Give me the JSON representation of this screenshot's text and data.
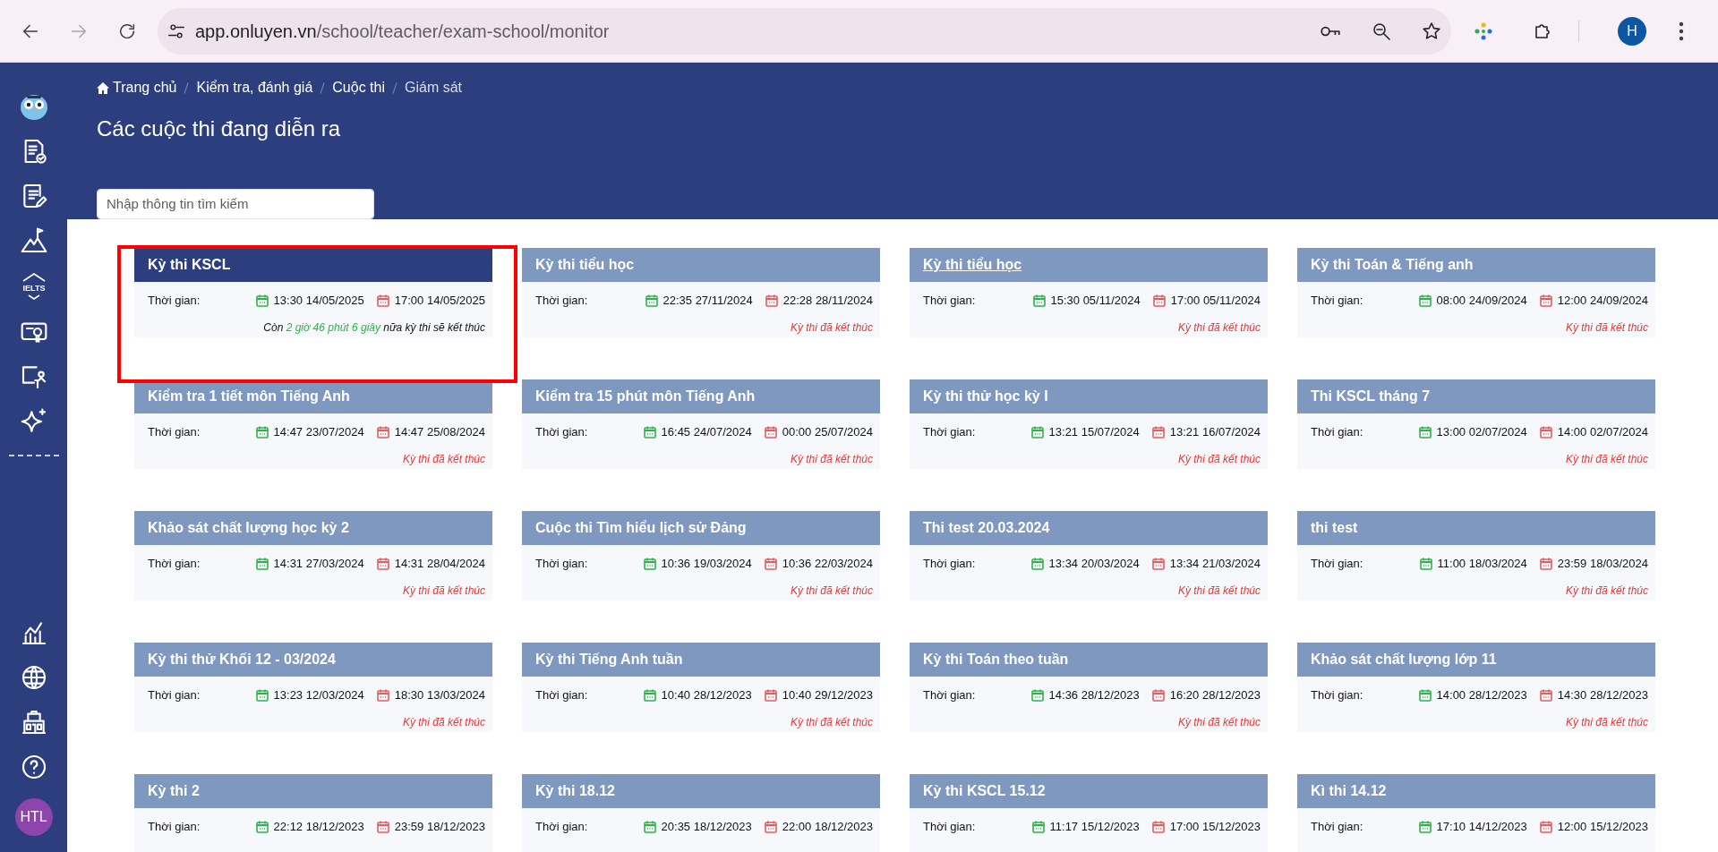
{
  "browser": {
    "url_domain": "app.onluyen.vn",
    "url_path": "/school/teacher/exam-school/monitor",
    "forward_disabled": true,
    "profile": "H"
  },
  "sidebar": {
    "ielts_label": "IELTS",
    "avatar": "HTL"
  },
  "breadcrumb": [
    {
      "label": "Trang chủ",
      "home": true
    },
    {
      "label": "Kiểm tra, đánh giá",
      "home": false
    },
    {
      "label": "Cuộc thi",
      "home": false
    },
    {
      "label": "Giám sát",
      "home": false
    }
  ],
  "page_title": "Các cuộc thi đang diễn ra",
  "search": {
    "placeholder": "Nhập thông tin tìm kiếm"
  },
  "exams": [
    {
      "title": "Kỳ thi KSCL",
      "selected": true,
      "underlined": false,
      "time_label": "Thời gian:",
      "start": "13:30 14/05/2025",
      "end": "17:00 14/05/2025",
      "status": {
        "kind": "countdown",
        "prefix": "Còn",
        "remaining": "2 giờ 46 phút 6 giây",
        "suffix": "nữa kỳ thi sẽ kết thúc"
      }
    },
    {
      "title": "Kỳ thi tiểu học",
      "selected": false,
      "underlined": false,
      "time_label": "Thời gian:",
      "start": "22:35 27/11/2024",
      "end": "22:28 28/11/2024",
      "status": {
        "kind": "ended",
        "text": "Kỳ thi đã kết thúc"
      }
    },
    {
      "title": "Kỳ thi tiểu học",
      "selected": false,
      "underlined": true,
      "time_label": "Thời gian:",
      "start": "15:30 05/11/2024",
      "end": "17:00 05/11/2024",
      "status": {
        "kind": "ended",
        "text": "Kỳ thi đã kết thúc"
      }
    },
    {
      "title": "Kỳ thi Toán & Tiếng anh",
      "selected": false,
      "underlined": false,
      "time_label": "Thời gian:",
      "start": "08:00 24/09/2024",
      "end": "12:00 24/09/2024",
      "status": {
        "kind": "ended",
        "text": "Kỳ thi đã kết thúc"
      }
    },
    {
      "title": "Kiểm tra 1 tiết môn Tiếng Anh",
      "selected": false,
      "underlined": false,
      "time_label": "Thời gian:",
      "start": "14:47 23/07/2024",
      "end": "14:47 25/08/2024",
      "status": {
        "kind": "ended",
        "text": "Kỳ thi đã kết thúc"
      }
    },
    {
      "title": "Kiểm tra 15 phút môn Tiếng Anh",
      "selected": false,
      "underlined": false,
      "time_label": "Thời gian:",
      "start": "16:45 24/07/2024",
      "end": "00:00 25/07/2024",
      "status": {
        "kind": "ended",
        "text": "Kỳ thi đã kết thúc"
      }
    },
    {
      "title": "Kỳ thi thử học kỳ I",
      "selected": false,
      "underlined": false,
      "time_label": "Thời gian:",
      "start": "13:21 15/07/2024",
      "end": "13:21 16/07/2024",
      "status": {
        "kind": "ended",
        "text": "Kỳ thi đã kết thúc"
      }
    },
    {
      "title": "Thi KSCL tháng 7",
      "selected": false,
      "underlined": false,
      "time_label": "Thời gian:",
      "start": "13:00 02/07/2024",
      "end": "14:00 02/07/2024",
      "status": {
        "kind": "ended",
        "text": "Kỳ thi đã kết thúc"
      }
    },
    {
      "title": "Khảo sát chất lượng học kỳ 2",
      "selected": false,
      "underlined": false,
      "time_label": "Thời gian:",
      "start": "14:31 27/03/2024",
      "end": "14:31 28/04/2024",
      "status": {
        "kind": "ended",
        "text": "Kỳ thi đã kết thúc"
      }
    },
    {
      "title": "Cuộc thi Tìm hiểu lịch sử Đảng",
      "selected": false,
      "underlined": false,
      "time_label": "Thời gian:",
      "start": "10:36 19/03/2024",
      "end": "10:36 22/03/2024",
      "status": {
        "kind": "ended",
        "text": "Kỳ thi đã kết thúc"
      }
    },
    {
      "title": "Thi test 20.03.2024",
      "selected": false,
      "underlined": false,
      "time_label": "Thời gian:",
      "start": "13:34 20/03/2024",
      "end": "13:34 21/03/2024",
      "status": {
        "kind": "ended",
        "text": "Kỳ thi đã kết thúc"
      }
    },
    {
      "title": "thi test",
      "selected": false,
      "underlined": false,
      "time_label": "Thời gian:",
      "start": "11:00 18/03/2024",
      "end": "23:59 18/03/2024",
      "status": {
        "kind": "ended",
        "text": "Kỳ thi đã kết thúc"
      }
    },
    {
      "title": "Kỳ thi thử Khối 12 - 03/2024",
      "selected": false,
      "underlined": false,
      "time_label": "Thời gian:",
      "start": "13:23 12/03/2024",
      "end": "18:30 13/03/2024",
      "status": {
        "kind": "ended",
        "text": "Kỳ thi đã kết thúc"
      }
    },
    {
      "title": "Kỳ thi Tiếng Anh tuần",
      "selected": false,
      "underlined": false,
      "time_label": "Thời gian:",
      "start": "10:40 28/12/2023",
      "end": "10:40 29/12/2023",
      "status": {
        "kind": "ended",
        "text": "Kỳ thi đã kết thúc"
      }
    },
    {
      "title": "Kỳ thi Toán theo tuần",
      "selected": false,
      "underlined": false,
      "time_label": "Thời gian:",
      "start": "14:36 28/12/2023",
      "end": "16:20 28/12/2023",
      "status": {
        "kind": "ended",
        "text": "Kỳ thi đã kết thúc"
      }
    },
    {
      "title": "Khảo sát chất lượng lớp 11",
      "selected": false,
      "underlined": false,
      "time_label": "Thời gian:",
      "start": "14:00 28/12/2023",
      "end": "14:30 28/12/2023",
      "status": {
        "kind": "ended",
        "text": "Kỳ thi đã kết thúc"
      }
    },
    {
      "title": "Kỳ thi 2",
      "selected": false,
      "underlined": false,
      "time_label": "Thời gian:",
      "start": "22:12 18/12/2023",
      "end": "23:59 18/12/2023"
    },
    {
      "title": "Kỳ thi 18.12",
      "selected": false,
      "underlined": false,
      "time_label": "Thời gian:",
      "start": "20:35 18/12/2023",
      "end": "22:00 18/12/2023"
    },
    {
      "title": "Kỳ thi KSCL 15.12",
      "selected": false,
      "underlined": false,
      "time_label": "Thời gian:",
      "start": "11:17 15/12/2023",
      "end": "17:00 15/12/2023"
    },
    {
      "title": "Kì thi 14.12",
      "selected": false,
      "underlined": false,
      "time_label": "Thời gian:",
      "start": "17:10 14/12/2023",
      "end": "12:00 15/12/2023"
    }
  ]
}
